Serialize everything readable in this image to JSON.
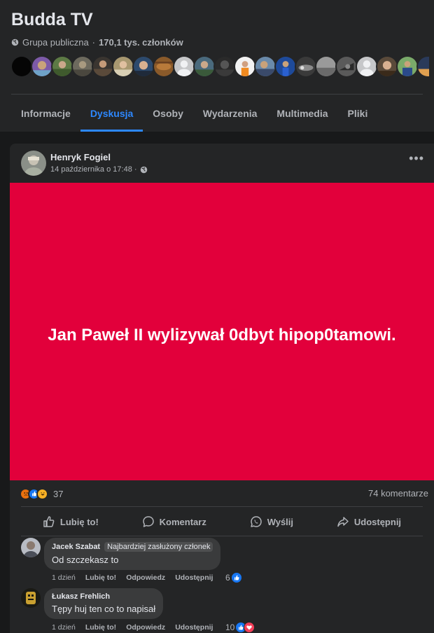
{
  "group": {
    "title": "Budda TV",
    "privacy": "Grupa publiczna",
    "separator": "·",
    "members": "170,1 tys. członków"
  },
  "tabs": [
    {
      "label": "Informacje"
    },
    {
      "label": "Dyskusja"
    },
    {
      "label": "Osoby"
    },
    {
      "label": "Wydarzenia"
    },
    {
      "label": "Multimedia"
    },
    {
      "label": "Pliki"
    }
  ],
  "post": {
    "author": "Henryk Fogiel",
    "time": "14 października o 17:48 ·",
    "banner_text": "Jan Paweł II wylizywał 0dbyt hipop0tamowi.",
    "reaction_count": "37",
    "comment_count": "74 komentarze",
    "actions": {
      "like": "Lubię to!",
      "comment": "Komentarz",
      "send": "Wyślij",
      "share": "Udostępnij"
    }
  },
  "comments": [
    {
      "author": "Jacek Szabat",
      "badge": "Najbardziej zasłużony członek",
      "text": "Od szczekasz to",
      "time": "1 dzień",
      "like": "Lubię to!",
      "reply": "Odpowiedz",
      "share": "Udostępnij",
      "reactions": "6"
    },
    {
      "author": "Łukasz Frehlich",
      "text": "Tępy huj ten co to napisał",
      "time": "1 dzień",
      "like": "Lubię to!",
      "reply": "Odpowiedz",
      "share": "Udostępnij",
      "reactions": "10"
    }
  ],
  "colors": {
    "accent": "#2d88ff",
    "banner": "#e2003b",
    "surface": "#242526",
    "background": "#18191a"
  }
}
